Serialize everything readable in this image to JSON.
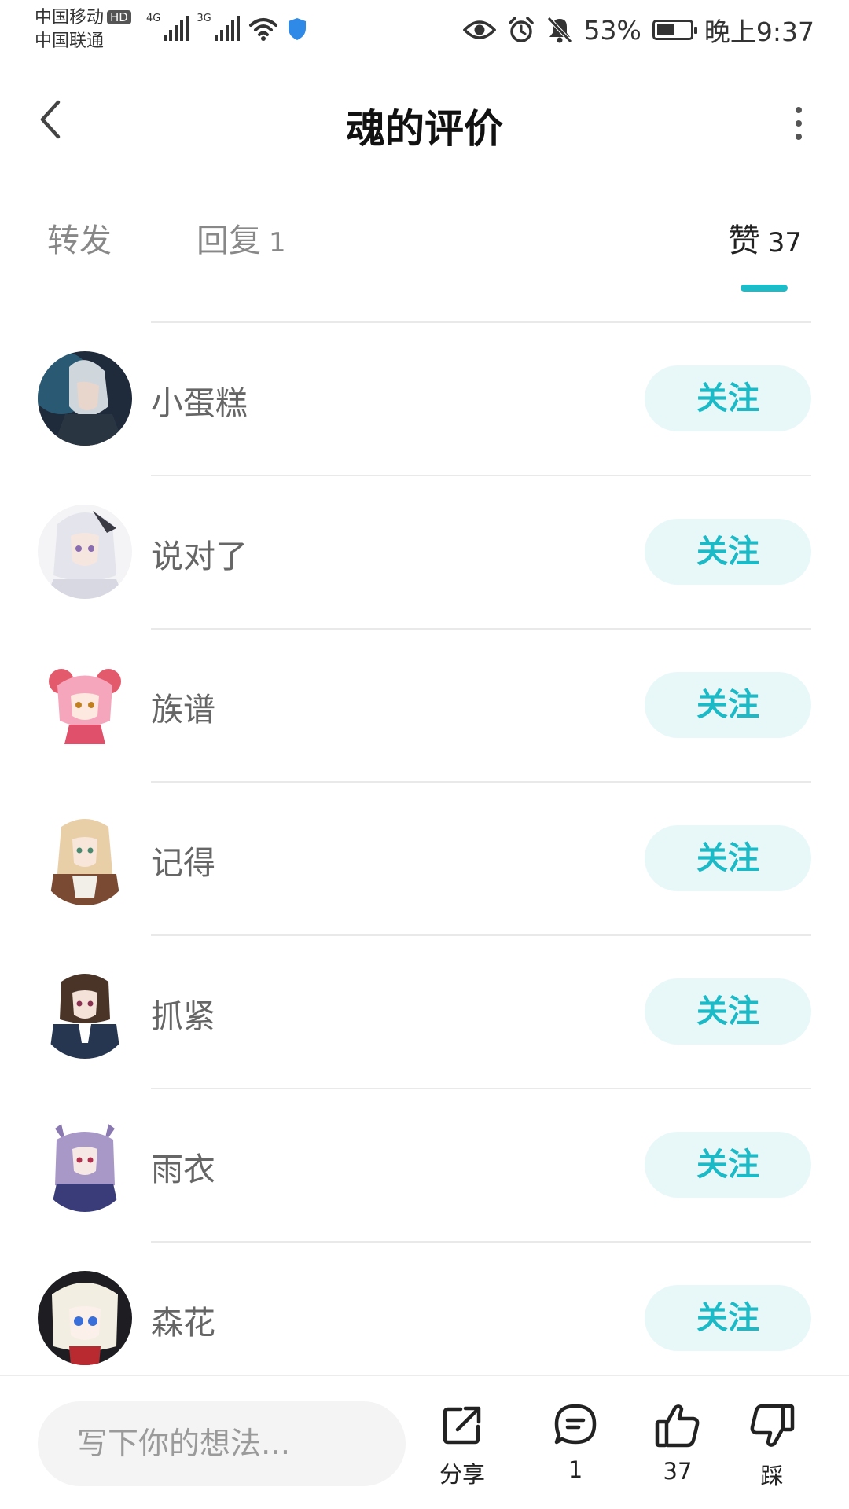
{
  "status_bar": {
    "carrier_1": "中国移动",
    "hd_badge": "HD",
    "carrier_2": "中国联通",
    "signal_1_label": "4G",
    "signal_2_label": "3G",
    "battery_percent": "53%",
    "battery_level": 0.53,
    "time": "晚上9:37"
  },
  "header": {
    "title": "魂的评价"
  },
  "tabs": [
    {
      "label": "转发",
      "count": ""
    },
    {
      "label": "回复",
      "count": "1"
    },
    {
      "label": "赞",
      "count": "37"
    }
  ],
  "active_tab": "赞",
  "users": [
    {
      "name": "小蛋糕",
      "follow_label": "关注"
    },
    {
      "name": "说对了",
      "follow_label": "关注"
    },
    {
      "name": "族谱",
      "follow_label": "关注"
    },
    {
      "name": "记得",
      "follow_label": "关注"
    },
    {
      "name": "抓紧",
      "follow_label": "关注"
    },
    {
      "name": "雨衣",
      "follow_label": "关注"
    },
    {
      "name": "森花",
      "follow_label": "关注"
    }
  ],
  "bottom_bar": {
    "input_placeholder": "写下你的想法...",
    "share_label": "分享",
    "comment_count": "1",
    "like_count": "37",
    "dislike_label": "踩"
  },
  "colors": {
    "accent": "#1cb9c6",
    "follow_bg": "#e8f8f9"
  }
}
